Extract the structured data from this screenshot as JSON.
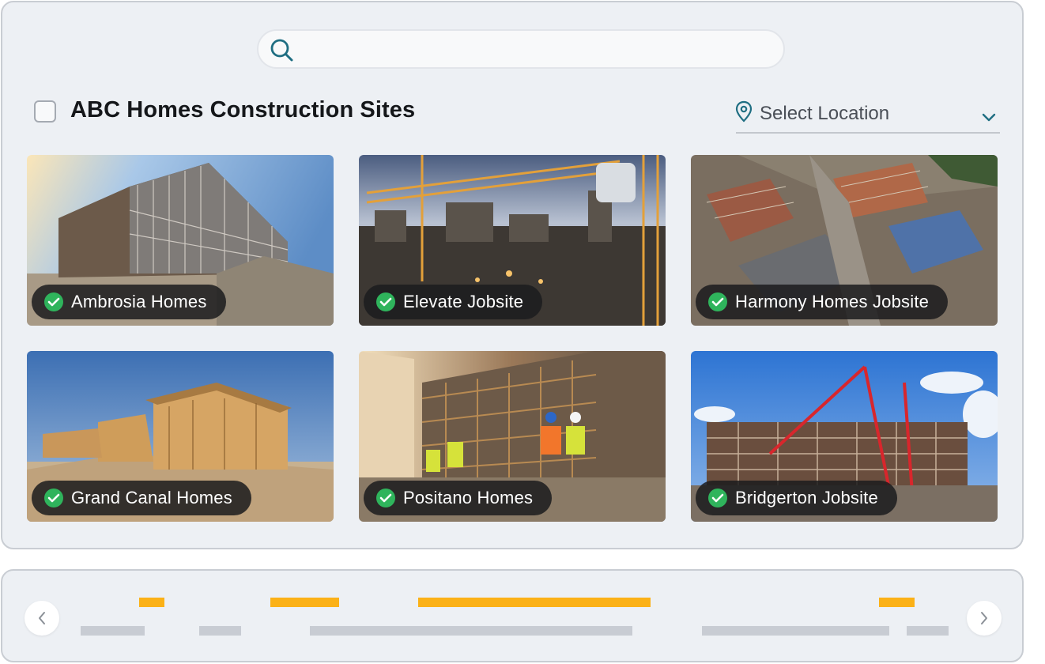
{
  "search": {
    "placeholder": "",
    "icon": "search-icon"
  },
  "header": {
    "title": "ABC Homes Construction Sites",
    "select_all_checked": false
  },
  "location": {
    "label": "Select Location",
    "icon": "location-pin-icon",
    "chevron": "chevron-down-icon"
  },
  "colors": {
    "accent": "#1f7a8c",
    "status_green": "#2fb45c",
    "timeline_active": "#fbb117",
    "timeline_inactive": "#c8ccd3"
  },
  "sites": [
    {
      "name": "Ambrosia Homes",
      "status": "active"
    },
    {
      "name": "Elevate Jobsite",
      "status": "active"
    },
    {
      "name": "Harmony Homes Jobsite",
      "status": "active"
    },
    {
      "name": "Grand Canal Homes",
      "status": "active"
    },
    {
      "name": "Positano Homes",
      "status": "active"
    },
    {
      "name": "Bridgerton Jobsite",
      "status": "active"
    }
  ],
  "timeline": {
    "prev_icon": "chevron-left-icon",
    "next_icon": "chevron-right-icon"
  }
}
